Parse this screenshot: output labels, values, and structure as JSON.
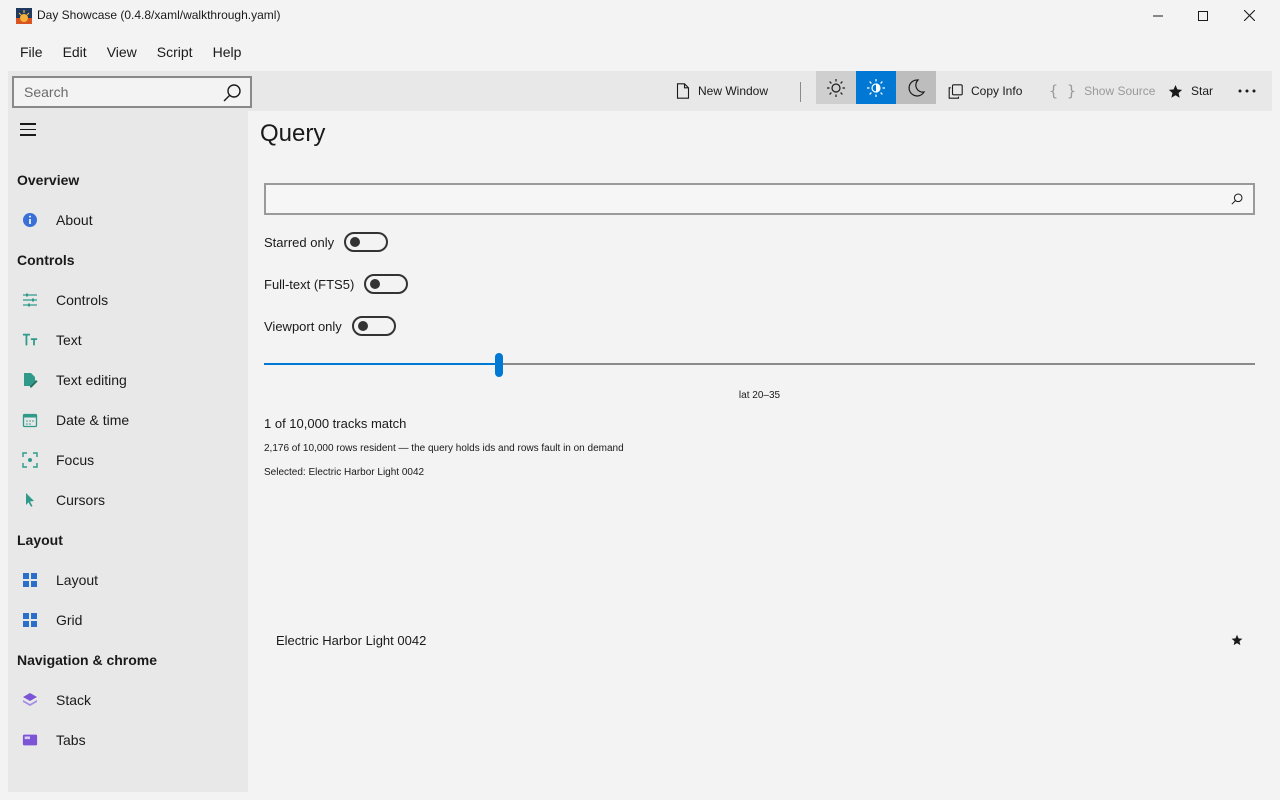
{
  "window": {
    "title": "Day Showcase (0.4.8/xaml/walkthrough.yaml)"
  },
  "menu": [
    "File",
    "Edit",
    "View",
    "Script",
    "Help"
  ],
  "toolbar": {
    "search_placeholder": "Search",
    "new_window": "New Window",
    "copy_info": "Copy Info",
    "show_source": "Show Source",
    "star": "Star",
    "theme_selected": "auto"
  },
  "sidebar": {
    "sections": [
      {
        "title": "Overview",
        "items": [
          {
            "label": "About",
            "icon": "info-icon"
          }
        ]
      },
      {
        "title": "Controls",
        "items": [
          {
            "label": "Controls",
            "icon": "sliders-icon"
          },
          {
            "label": "Text",
            "icon": "text-icon"
          },
          {
            "label": "Text editing",
            "icon": "edit-icon"
          },
          {
            "label": "Date & time",
            "icon": "calendar-icon"
          },
          {
            "label": "Focus",
            "icon": "focus-icon"
          },
          {
            "label": "Cursors",
            "icon": "cursor-icon"
          }
        ]
      },
      {
        "title": "Layout",
        "items": [
          {
            "label": "Layout",
            "icon": "layout-icon"
          },
          {
            "label": "Grid",
            "icon": "grid-icon"
          }
        ]
      },
      {
        "title": "Navigation & chrome",
        "items": [
          {
            "label": "Stack",
            "icon": "stack-icon"
          },
          {
            "label": "Tabs",
            "icon": "tabs-icon"
          }
        ]
      }
    ]
  },
  "page": {
    "title": "Query",
    "query_value": "",
    "toggles": [
      {
        "label": "Starred only",
        "on": false
      },
      {
        "label": "Full-text (FTS5)",
        "on": false
      },
      {
        "label": "Viewport only",
        "on": false
      }
    ],
    "slider": {
      "value_fraction": 0.237,
      "caption": "lat 20–35"
    },
    "match_count": "1 of 10,000 tracks match",
    "resident_info": "2,176 of 10,000 rows resident — the query holds ids and rows fault in on demand",
    "selected_info": "Selected: Electric Harbor Light 0042",
    "results": [
      {
        "title": "Electric Harbor Light 0042",
        "starred": true
      }
    ]
  },
  "colors": {
    "accent": "#0078d4",
    "background": "#f3f3f3",
    "pane": "#e8e8e8"
  }
}
